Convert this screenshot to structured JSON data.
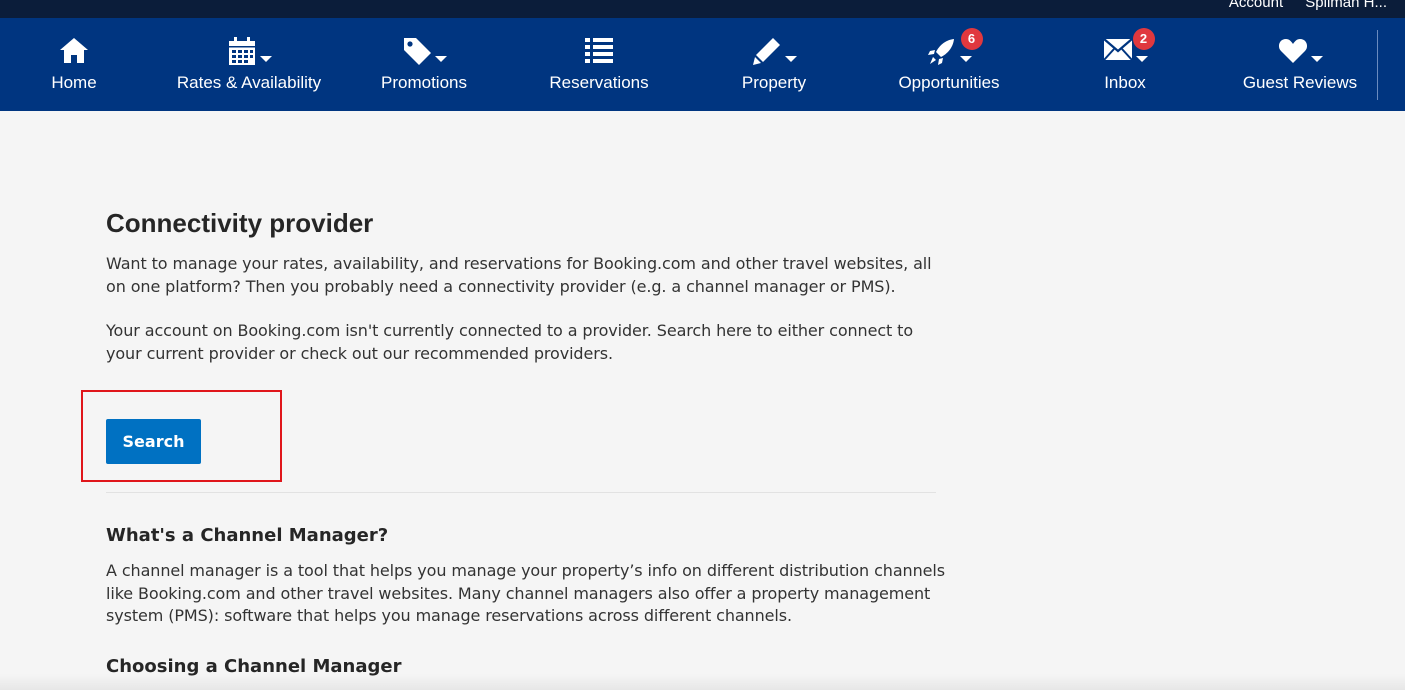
{
  "topbar": {
    "account_label": "Account",
    "property_label": "Spilman H..."
  },
  "nav": {
    "items": [
      {
        "label": "Home",
        "icon": "home-icon"
      },
      {
        "label": "Rates & Availability",
        "icon": "calendar-icon"
      },
      {
        "label": "Promotions",
        "icon": "tag-icon"
      },
      {
        "label": "Reservations",
        "icon": "list-icon"
      },
      {
        "label": "Property",
        "icon": "pencil-icon"
      },
      {
        "label": "Opportunities",
        "icon": "rocket-icon",
        "badge": "6"
      },
      {
        "label": "Inbox",
        "icon": "envelope-icon",
        "badge": "2"
      },
      {
        "label": "Guest Reviews",
        "icon": "heart-icon"
      }
    ]
  },
  "main": {
    "title": "Connectivity provider",
    "intro_p1": "Want to manage your rates, availability, and reservations for Booking.com and other travel websites, all on one platform? Then you probably need a connectivity provider (e.g. a channel manager or PMS).",
    "intro_p2": "Your account on Booking.com isn't currently connected to a provider. Search here to either connect to your current provider or check out our recommended providers.",
    "search_label": "Search",
    "section1_title": "What's a Channel Manager?",
    "section1_body": "A channel manager is a tool that helps you manage your property’s info on different distribution channels like Booking.com and other travel websites. Many channel managers also offer a property management system (PMS): software that helps you manage reservations across different channels.",
    "section2_title": "Choosing a Channel Manager"
  },
  "colors": {
    "nav_bg": "#003580",
    "button_bg": "#0071c2",
    "badge_bg": "#e0383e",
    "highlight": "#e0161b"
  }
}
